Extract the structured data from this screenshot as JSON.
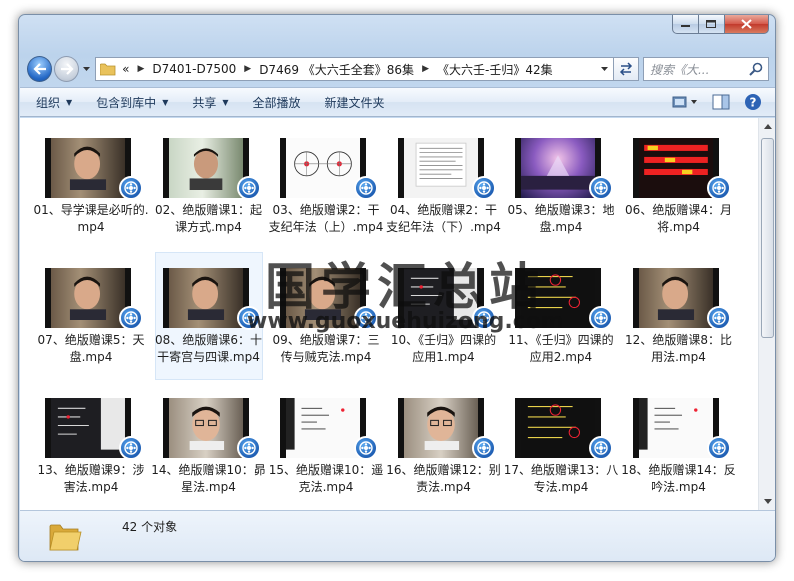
{
  "address": {
    "overflow_glyph": "«",
    "crumbs": [
      "D7401-D7500",
      "D7469 《大六壬全套》86集",
      "《大六壬-壬归》42集"
    ]
  },
  "search": {
    "placeholder": "搜索《大..."
  },
  "toolbar": {
    "organize": "组织",
    "include_library": "包含到库中",
    "share": "共享",
    "play_all": "全部播放",
    "new_folder": "新建文件夹"
  },
  "files": [
    {
      "name": "01、导学课是必听的.mp4",
      "scene": "face-room"
    },
    {
      "name": "02、绝版赠课1：起课方式.mp4",
      "scene": "face-window"
    },
    {
      "name": "03、绝版赠课2：干支纪年法（上）.mp4",
      "scene": "diagram-circles"
    },
    {
      "name": "04、绝版赠课2：干支纪年法（下）.mp4",
      "scene": "document"
    },
    {
      "name": "05、绝版赠课3：地盘.mp4",
      "scene": "stage-purple"
    },
    {
      "name": "06、绝版赠课4：月将.mp4",
      "scene": "red-text"
    },
    {
      "name": "07、绝版赠课5：天盘.mp4",
      "scene": "face-room"
    },
    {
      "name": "08、绝版赠课6：十干寄宫与四课.mp4",
      "scene": "face-room"
    },
    {
      "name": "09、绝版赠课7：三传与贼克法.mp4",
      "scene": "face-room"
    },
    {
      "name": "10、《壬归》四课的应用1.mp4",
      "scene": "dark-slide"
    },
    {
      "name": "11、《壬归》四课的应用2.mp4",
      "scene": "blackboard"
    },
    {
      "name": "12、绝版赠课8：比用法.mp4",
      "scene": "face-room"
    },
    {
      "name": "13、绝版赠课9：涉害法.mp4",
      "scene": "dark-slide"
    },
    {
      "name": "14、绝版赠课10：昴星法.mp4",
      "scene": "face-glasses"
    },
    {
      "name": "15、绝版赠课10：遥克法.mp4",
      "scene": "white-slide"
    },
    {
      "name": "16、绝版赠课12：别责法.mp4",
      "scene": "face-glasses"
    },
    {
      "name": "17、绝版赠课13：八专法.mp4",
      "scene": "blackboard"
    },
    {
      "name": "18、绝版赠课14：反吟法.mp4",
      "scene": "white-slide"
    }
  ],
  "status": {
    "count_text": "42 个对象"
  },
  "watermark": {
    "title": "国学汇总站",
    "url": "www.guoxuehuizong.com"
  },
  "colors": {
    "accent": "#2468c6",
    "selection": "#dcebfc",
    "toolbar_text": "#1e395b"
  }
}
